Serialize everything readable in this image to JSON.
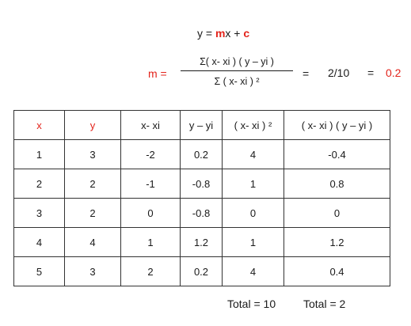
{
  "equation": {
    "y": "y",
    "eq": "=",
    "m": "m",
    "x_plus": "x +",
    "c": "c"
  },
  "slope": {
    "label": "m =",
    "numerator": "Σ( x- xi ) ( y – yi )",
    "denominator": "Σ ( x- xi ) ²",
    "equals": "=",
    "ratio": "2/10",
    "equals2": "=",
    "result": "0.2"
  },
  "table": {
    "headers": [
      "x",
      "y",
      "x- xi",
      "y – yi",
      "( x- xi ) ²",
      "( x- xi ) ( y – yi )"
    ],
    "rows": [
      [
        "1",
        "3",
        "-2",
        "0.2",
        "4",
        "-0.4"
      ],
      [
        "2",
        "2",
        "-1",
        "-0.8",
        "1",
        "0.8"
      ],
      [
        "3",
        "2",
        "0",
        "-0.8",
        "0",
        "0"
      ],
      [
        "4",
        "4",
        "1",
        "1.2",
        "1",
        "1.2"
      ],
      [
        "5",
        "3",
        "2",
        "0.2",
        "4",
        "0.4"
      ]
    ]
  },
  "totals": {
    "sq": "Total = 10",
    "prod": "Total = 2"
  },
  "colors": {
    "accent": "#e3231b",
    "text": "#1a1a1a",
    "border": "#333333"
  }
}
